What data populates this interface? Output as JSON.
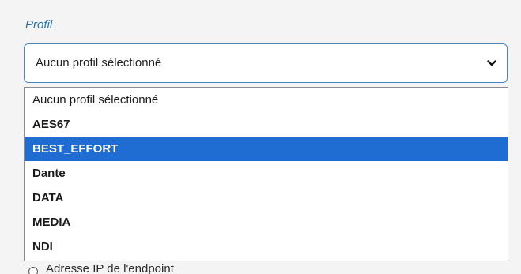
{
  "form": {
    "field_label": "Profil",
    "select": {
      "value": "Aucun profil sélectionné",
      "icon": "chevron-down-icon",
      "border_color": "#4a87bb"
    },
    "options": [
      {
        "label": "Aucun profil sélectionné",
        "selected": false
      },
      {
        "label": "AES67",
        "selected": false
      },
      {
        "label": "BEST_EFFORT",
        "selected": true
      },
      {
        "label": "Dante",
        "selected": false
      },
      {
        "label": "DATA",
        "selected": false
      },
      {
        "label": "MEDIA",
        "selected": false
      },
      {
        "label": "NDI",
        "selected": false
      }
    ],
    "highlight_color": "#1f6dd3",
    "radio_label": "Adresse IP de l'endpoint"
  }
}
